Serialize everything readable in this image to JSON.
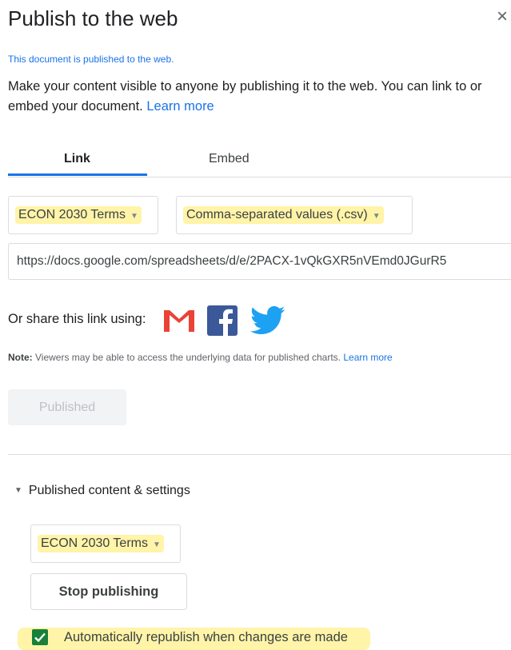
{
  "dialog": {
    "title": "Publish to the web",
    "close_icon": "close-icon"
  },
  "status": "This document is published to the web.",
  "description": {
    "text": "Make your content visible to anyone by publishing it to the web. You can link to or embed your document. ",
    "learn_more": "Learn more"
  },
  "tabs": [
    {
      "label": "Link",
      "active": true
    },
    {
      "label": "Embed",
      "active": false
    }
  ],
  "sheet_select": {
    "value": "ECON 2030 Terms"
  },
  "format_select": {
    "value": "Comma-separated values (.csv)"
  },
  "url": "https://docs.google.com/spreadsheets/d/e/2PACX-1vQkGXR5nVEmd0JGurR5",
  "share": {
    "label": "Or share this link using:",
    "services": [
      "gmail-icon",
      "facebook-icon",
      "twitter-icon"
    ]
  },
  "note": {
    "prefix": "Note:",
    "text": " Viewers may be able to access the underlying data for published charts. ",
    "learn_more": "Learn more"
  },
  "published_button": "Published",
  "settings": {
    "toggle_label": "Published content & settings",
    "sheet_select": {
      "value": "ECON 2030 Terms"
    },
    "stop_button": "Stop publishing",
    "auto_republish": {
      "label": "Automatically republish when changes are made",
      "checked": true
    }
  },
  "colors": {
    "accent": "#1a73e8",
    "highlight": "#fff4a8",
    "checkbox": "#188038",
    "gmail": "#ea4335",
    "facebook": "#3b5998",
    "twitter": "#1da1f2"
  }
}
